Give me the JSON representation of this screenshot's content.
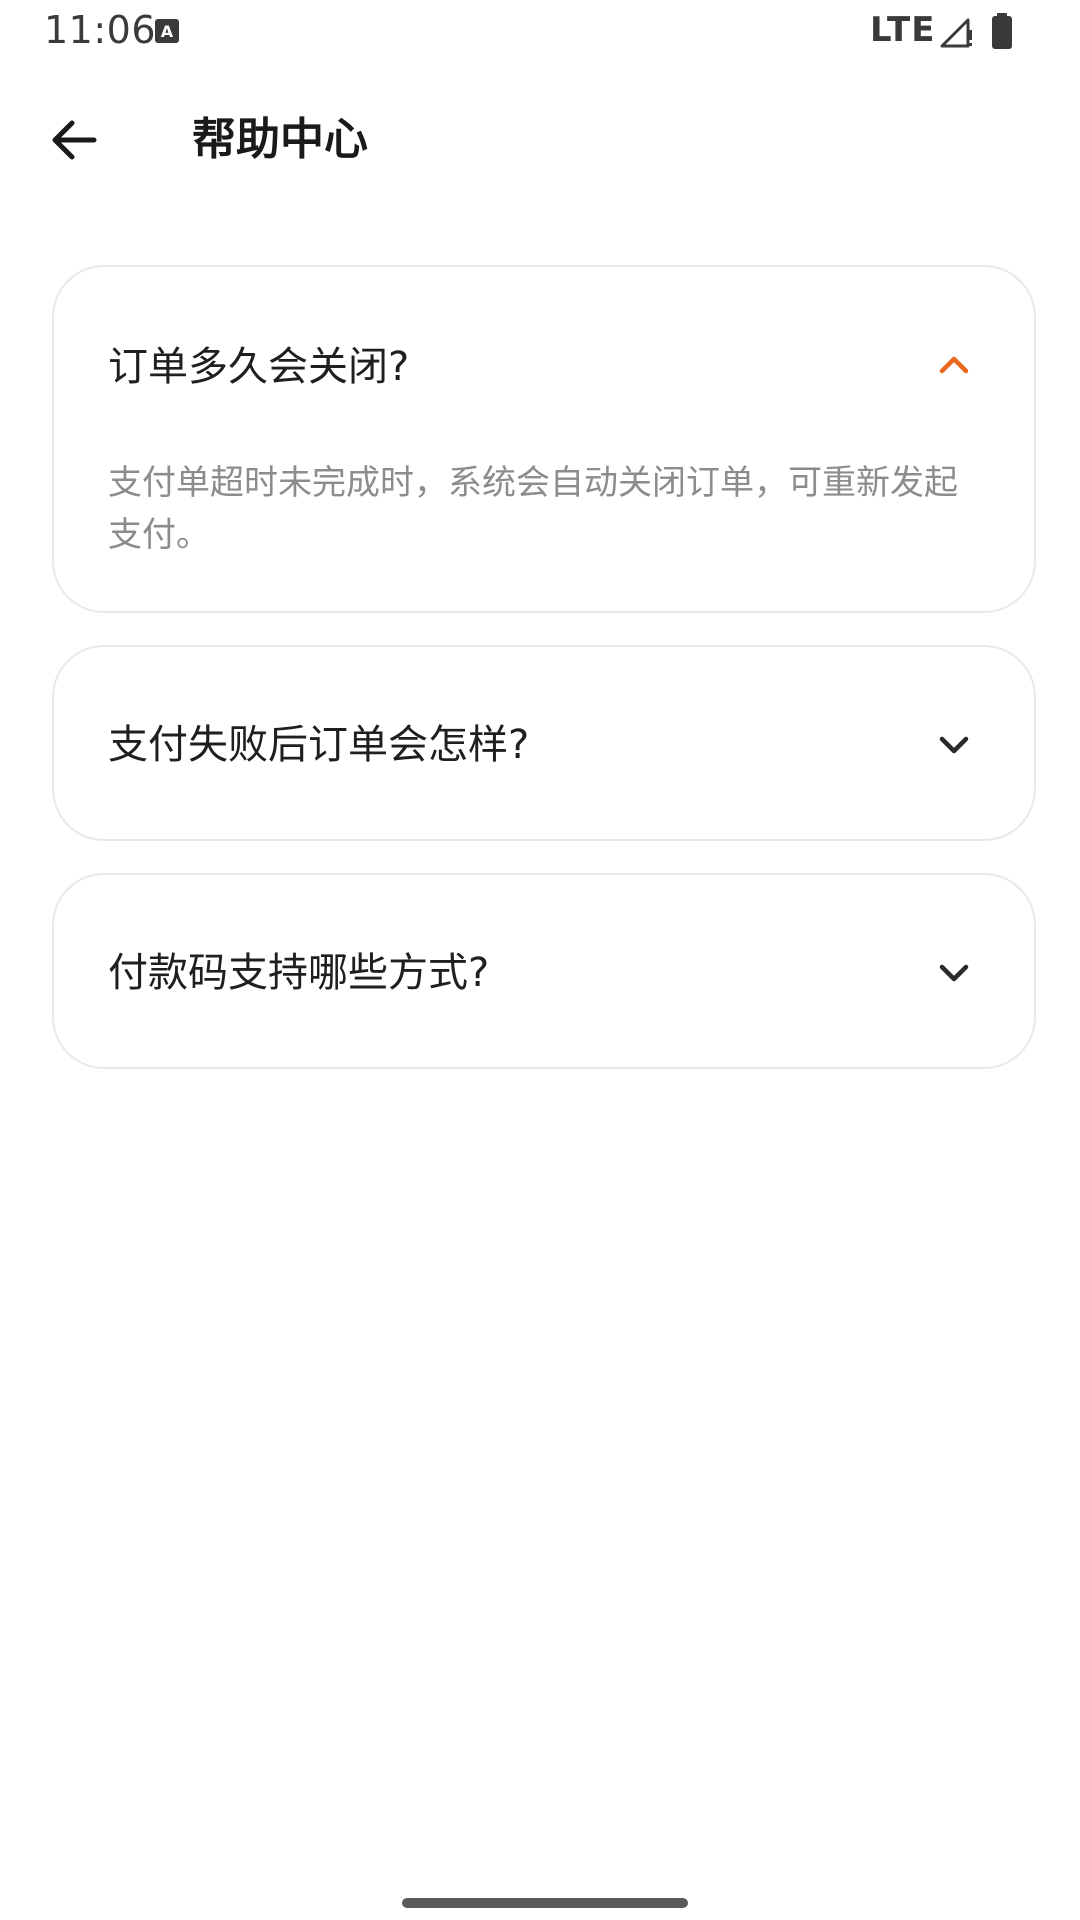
{
  "status_bar": {
    "time": "11:06",
    "network": "LTE",
    "icons": [
      "text-a-icon",
      "signal-icon",
      "battery-icon"
    ]
  },
  "app_bar": {
    "title": "帮助中心",
    "back_icon": "arrow-left-icon"
  },
  "faqs": [
    {
      "question": "订单多久会关闭?",
      "answer": "支付单超时未完成时，系统会自动关闭订单，可重新发起支付。",
      "expanded": true,
      "chevron": "chevron-up-icon"
    },
    {
      "question": "支付失败后订单会怎样?",
      "expanded": false,
      "chevron": "chevron-down-icon"
    },
    {
      "question": "付款码支持哪些方式?",
      "expanded": false,
      "chevron": "chevron-down-icon"
    }
  ],
  "colors": {
    "accent": "#e8691f",
    "card_border": "#ece9e5",
    "answer_text": "#8c8c8c",
    "question_text": "#1f1f1f"
  }
}
